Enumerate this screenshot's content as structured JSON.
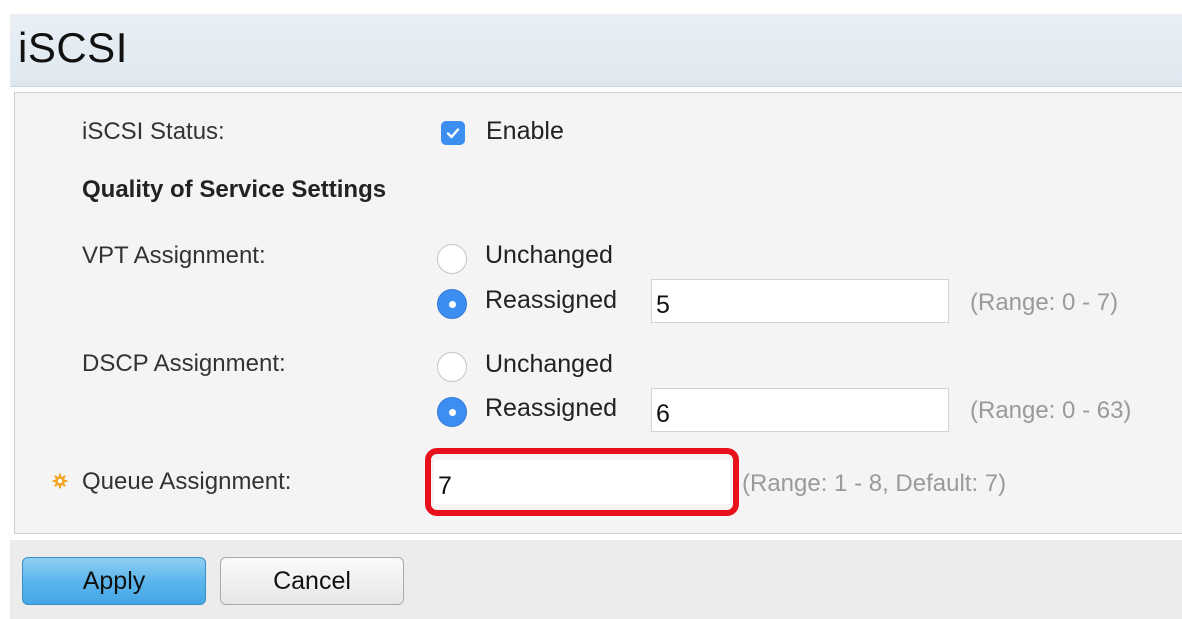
{
  "page": {
    "title": "iSCSI"
  },
  "iscsi_status": {
    "label": "iSCSI Status:",
    "checkbox_label": "Enable",
    "checked": true
  },
  "qos": {
    "heading": "Quality of Service Settings"
  },
  "vpt": {
    "label": "VPT Assignment:",
    "option_unchanged": "Unchanged",
    "option_reassigned": "Reassigned",
    "selected": "Reassigned",
    "value": "5",
    "range": "(Range: 0 - 7)"
  },
  "dscp": {
    "label": "DSCP Assignment:",
    "option_unchanged": "Unchanged",
    "option_reassigned": "Reassigned",
    "selected": "Reassigned",
    "value": "6",
    "range": "(Range: 0 - 63)"
  },
  "queue": {
    "label": "Queue Assignment:",
    "value": "7",
    "range": "(Range: 1 - 8, Default: 7)",
    "required_icon": "gear-icon"
  },
  "buttons": {
    "apply": "Apply",
    "cancel": "Cancel"
  },
  "colors": {
    "accent": "#3c8ef0",
    "highlight": "#e8101a",
    "required_icon": "#f5a623"
  }
}
